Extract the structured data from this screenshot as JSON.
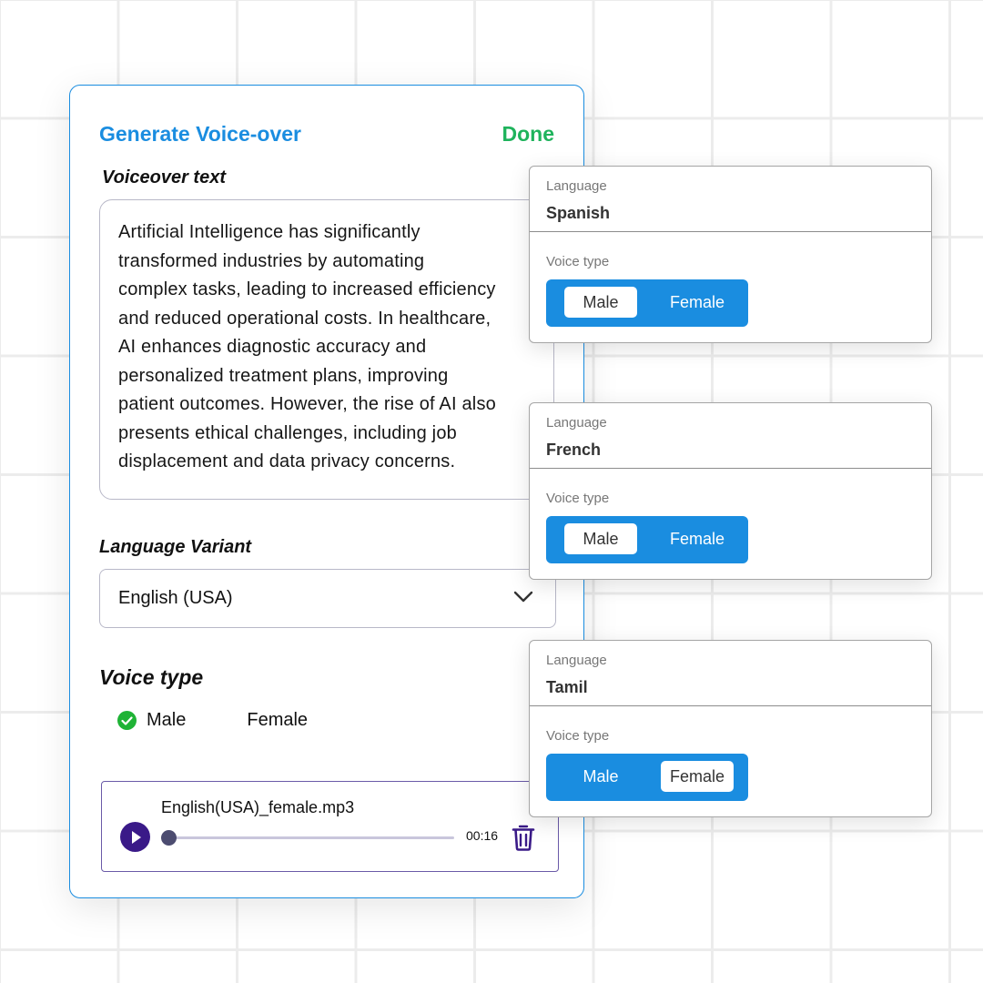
{
  "panel": {
    "title": "Generate Voice-over",
    "done_label": "Done",
    "voiceover_label": "Voiceover text",
    "voiceover_text": [
      "Artificial Intelligence has significantly",
      "transformed industries by automating",
      "complex tasks, leading to increased efficiency",
      "and reduced operational costs. In healthcare,",
      "AI enhances diagnostic accuracy and",
      "personalized treatment plans, improving",
      "patient outcomes. However, the rise of AI also",
      "presents ethical challenges, including job",
      "displacement and data privacy concerns."
    ],
    "language_variant_label": "Language Variant",
    "language_variant_value": "English (USA)",
    "voice_type_label": "Voice type",
    "voice_options": [
      "Male",
      "Female"
    ],
    "voice_selected": "Male",
    "accent_color": "#1a8de0",
    "done_color": "#1fb35c"
  },
  "player": {
    "file_name": "English(USA)_female.mp3",
    "duration": "00:16",
    "progress": 0.0
  },
  "cards": [
    {
      "language_label": "Language",
      "language": "Spanish",
      "voice_label": "Voice type",
      "options": [
        "Male",
        "Female"
      ],
      "selected": "Male"
    },
    {
      "language_label": "Language",
      "language": "French",
      "voice_label": "Voice type",
      "options": [
        "Male",
        "Female"
      ],
      "selected": "Male"
    },
    {
      "language_label": "Language",
      "language": "Tamil",
      "voice_label": "Voice type",
      "options": [
        "Male",
        "Female"
      ],
      "selected": "Female"
    }
  ]
}
